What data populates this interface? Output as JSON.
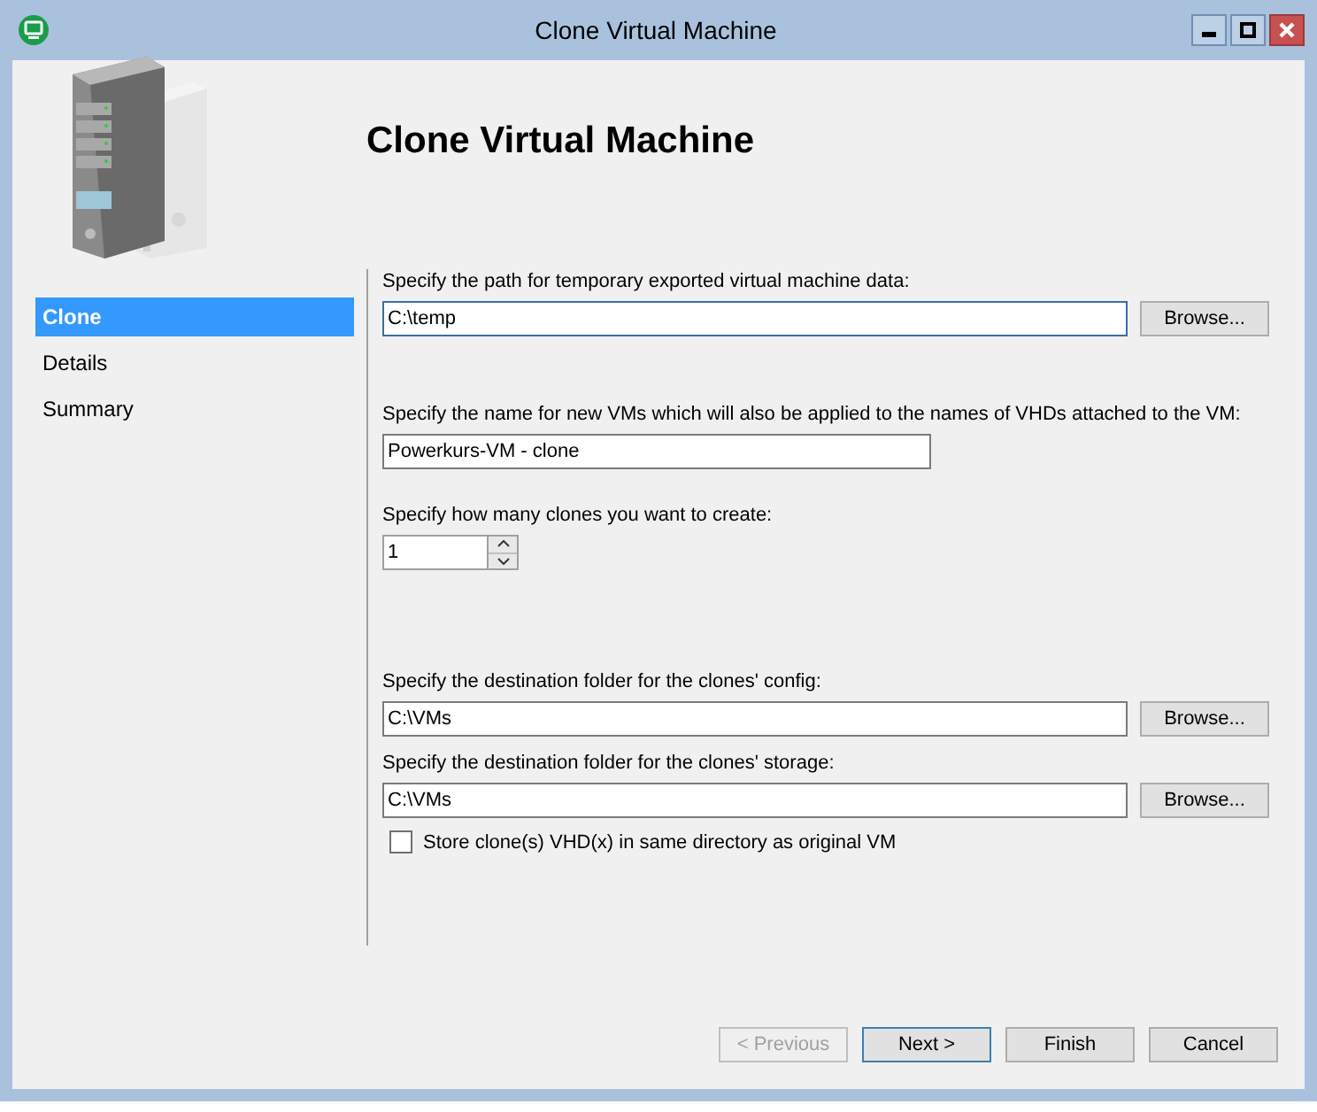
{
  "window": {
    "title": "Clone Virtual Machine"
  },
  "header": {
    "title": "Clone Virtual Machine"
  },
  "steps": [
    {
      "label": "Clone",
      "selected": true
    },
    {
      "label": "Details",
      "selected": false
    },
    {
      "label": "Summary",
      "selected": false
    }
  ],
  "fields": [
    {
      "kind": "path",
      "label": "Specify the path for temporary exported virtual machine data:",
      "value": "C:\\temp",
      "focused": true,
      "button": "Browse..."
    },
    {
      "kind": "text",
      "label": "Specify the name for new VMs which will also be applied to the names of VHDs attached to the VM:",
      "value": "Powerkurs-VM - clone",
      "focused": false
    },
    {
      "kind": "spinner",
      "label": "Specify how many clones you want to create:",
      "value": "1",
      "focused": false
    },
    {
      "kind": "path",
      "label": "Specify the destination folder for the clones' config:",
      "value": "C:\\VMs",
      "focused": false,
      "button": "Browse..."
    },
    {
      "kind": "path",
      "label": "Specify the destination folder for the clones' storage:",
      "value": "C:\\VMs",
      "focused": false,
      "button": "Browse..."
    }
  ],
  "checkbox": {
    "label": "Store clone(s) VHD(x) in same directory as original VM",
    "checked": false
  },
  "buttons": [
    {
      "label": "< Previous",
      "disabled": true,
      "default": false
    },
    {
      "label": "Next >",
      "disabled": false,
      "default": true
    },
    {
      "label": "Finish",
      "disabled": false,
      "default": false
    },
    {
      "label": "Cancel",
      "disabled": false,
      "default": false
    }
  ]
}
